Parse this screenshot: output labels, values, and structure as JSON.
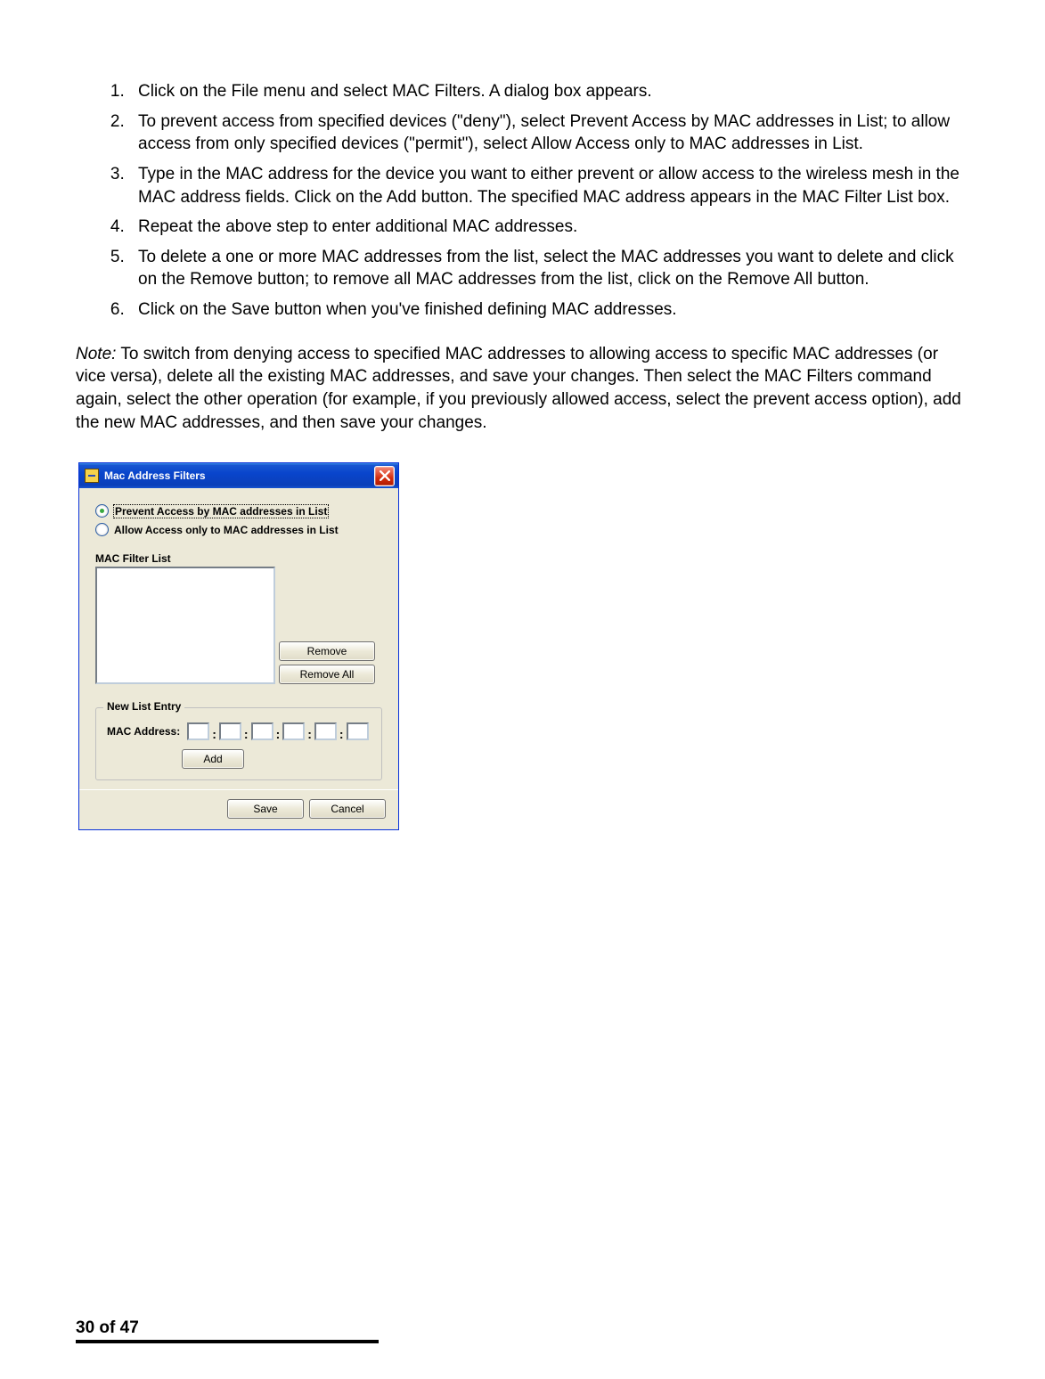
{
  "steps": {
    "s1": "Click on the File menu and select MAC Filters. A dialog box appears.",
    "s2": "To prevent access from specified devices (\"deny\"), select Prevent Access by MAC addresses in List; to allow access from only specified devices (\"permit\"), select Allow Access only to MAC addresses in List.",
    "s3": "Type in the MAC address for the device you want to either prevent or allow access to the wireless mesh in the MAC address fields. Click on the Add button. The specified MAC address appears in the MAC Filter List box.",
    "s4": "Repeat the above step to enter additional MAC addresses.",
    "s5": "To delete a one or more MAC addresses from the list, select the MAC addresses you want to delete and click on the Remove button; to remove all MAC addresses from the list, click on the Remove All button.",
    "s6": "Click on the Save button when you've finished defining MAC addresses."
  },
  "note_label": "Note:",
  "note_body": " To switch from denying access to specified MAC addresses to allowing access to specific MAC addresses (or vice versa), delete all the existing MAC addresses, and save your changes. Then select the MAC Filters command again, select the other operation (for example, if you previously allowed access, select the prevent access option), add the new MAC addresses, and then save your changes.",
  "dialog": {
    "title": "Mac Address Filters",
    "radio_prevent": "Prevent Access by MAC addresses in List",
    "radio_allow": "Allow Access only to MAC addresses in List",
    "filter_list_label": "MAC Filter List",
    "remove_label": "Remove",
    "remove_all_label": "Remove All",
    "new_entry_label": "New List Entry",
    "mac_address_label": "MAC Address:",
    "mac_sep": ":",
    "add_label": "Add",
    "save_label": "Save",
    "cancel_label": "Cancel"
  },
  "footer": "30 of 47"
}
